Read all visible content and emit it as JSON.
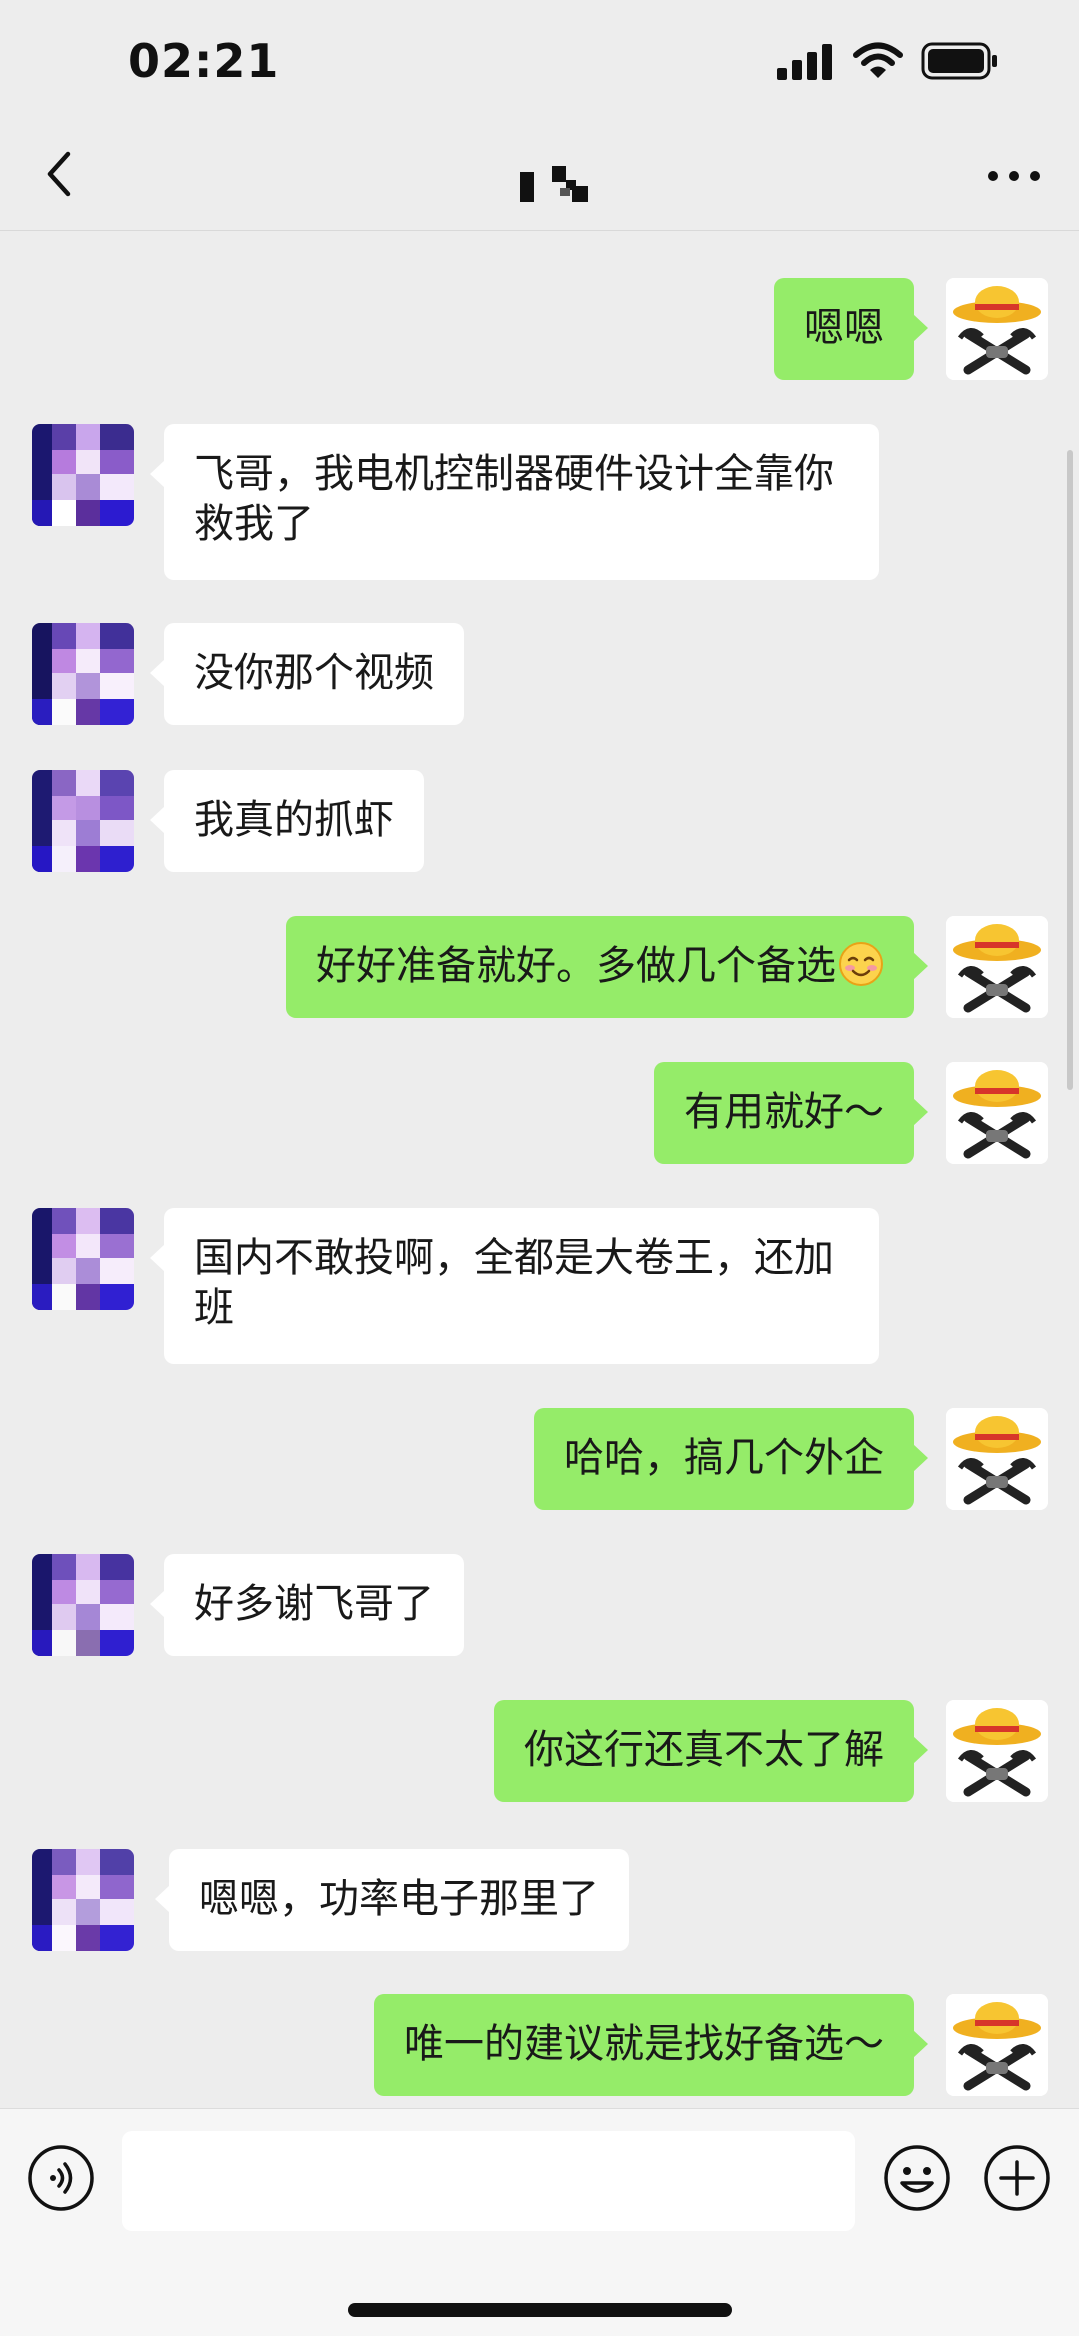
{
  "status_bar": {
    "time": "02:21",
    "icons": [
      "signal-icon",
      "wifi-icon",
      "battery-icon"
    ]
  },
  "nav": {
    "back_icon": "chevron-left-icon",
    "more_icon": "more-dots-icon"
  },
  "messages": [
    {
      "side": "right",
      "text": "嗯嗯"
    },
    {
      "side": "left",
      "text": "飞哥，我电机控制器硬件设计全靠你救我了"
    },
    {
      "side": "left",
      "text": "没你那个视频"
    },
    {
      "side": "left",
      "text": "我真的抓虾"
    },
    {
      "side": "right",
      "text": "好好准备就好。多做几个备选",
      "emoji": "blush-smile-emoji"
    },
    {
      "side": "right",
      "text": "有用就好～"
    },
    {
      "side": "left",
      "text": "国内不敢投啊，全都是大卷王，还加班"
    },
    {
      "side": "right",
      "text": "哈哈，搞几个外企"
    },
    {
      "side": "left",
      "text": "好多谢飞哥了"
    },
    {
      "side": "right",
      "text": "你这行还真不太了解"
    },
    {
      "side": "left",
      "text": "嗯嗯，功率电子那里了"
    },
    {
      "side": "right",
      "text": "唯一的建议就是找好备选～"
    }
  ],
  "input_bar": {
    "value": "",
    "voice_icon": "voice-icon",
    "emoji_icon": "emoji-icon",
    "plus_icon": "plus-icon"
  }
}
